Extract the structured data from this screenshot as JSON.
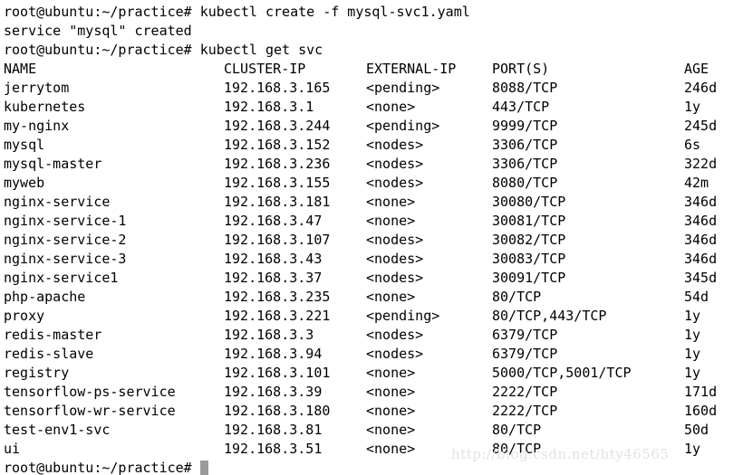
{
  "terminal": {
    "background_color": "#ffffff",
    "text_color": "#000000",
    "cursor_color": "#9a9a9a",
    "prompt": "root@ubuntu:~/practice#",
    "lines": {
      "command_1": "root@ubuntu:~/practice# kubectl create -f mysql-svc1.yaml",
      "output_1": "service \"mysql\" created",
      "command_2": "root@ubuntu:~/practice# kubectl get svc",
      "final_prompt": "root@ubuntu:~/practice#"
    }
  },
  "table": {
    "headers": {
      "name": "NAME",
      "cluster_ip": "CLUSTER-IP",
      "external_ip": "EXTERNAL-IP",
      "ports": "PORT(S)",
      "age": "AGE"
    },
    "rows": [
      {
        "name": "jerrytom",
        "cluster_ip": "192.168.3.165",
        "external_ip": "<pending>",
        "ports": "8088/TCP",
        "age": "246d"
      },
      {
        "name": "kubernetes",
        "cluster_ip": "192.168.3.1",
        "external_ip": "<none>",
        "ports": "443/TCP",
        "age": "1y"
      },
      {
        "name": "my-nginx",
        "cluster_ip": "192.168.3.244",
        "external_ip": "<pending>",
        "ports": "9999/TCP",
        "age": "245d"
      },
      {
        "name": "mysql",
        "cluster_ip": "192.168.3.152",
        "external_ip": "<nodes>",
        "ports": "3306/TCP",
        "age": "6s"
      },
      {
        "name": "mysql-master",
        "cluster_ip": "192.168.3.236",
        "external_ip": "<nodes>",
        "ports": "3306/TCP",
        "age": "322d"
      },
      {
        "name": "myweb",
        "cluster_ip": "192.168.3.155",
        "external_ip": "<nodes>",
        "ports": "8080/TCP",
        "age": "42m"
      },
      {
        "name": "nginx-service",
        "cluster_ip": "192.168.3.181",
        "external_ip": "<none>",
        "ports": "30080/TCP",
        "age": "346d"
      },
      {
        "name": "nginx-service-1",
        "cluster_ip": "192.168.3.47",
        "external_ip": "<none>",
        "ports": "30081/TCP",
        "age": "346d"
      },
      {
        "name": "nginx-service-2",
        "cluster_ip": "192.168.3.107",
        "external_ip": "<nodes>",
        "ports": "30082/TCP",
        "age": "346d"
      },
      {
        "name": "nginx-service-3",
        "cluster_ip": "192.168.3.43",
        "external_ip": "<nodes>",
        "ports": "30083/TCP",
        "age": "346d"
      },
      {
        "name": "nginx-service1",
        "cluster_ip": "192.168.3.37",
        "external_ip": "<nodes>",
        "ports": "30091/TCP",
        "age": "345d"
      },
      {
        "name": "php-apache",
        "cluster_ip": "192.168.3.235",
        "external_ip": "<none>",
        "ports": "80/TCP",
        "age": "54d"
      },
      {
        "name": "proxy",
        "cluster_ip": "192.168.3.221",
        "external_ip": "<pending>",
        "ports": "80/TCP,443/TCP",
        "age": "1y"
      },
      {
        "name": "redis-master",
        "cluster_ip": "192.168.3.3",
        "external_ip": "<nodes>",
        "ports": "6379/TCP",
        "age": "1y"
      },
      {
        "name": "redis-slave",
        "cluster_ip": "192.168.3.94",
        "external_ip": "<nodes>",
        "ports": "6379/TCP",
        "age": "1y"
      },
      {
        "name": "registry",
        "cluster_ip": "192.168.3.101",
        "external_ip": "<none>",
        "ports": "5000/TCP,5001/TCP",
        "age": "1y"
      },
      {
        "name": "tensorflow-ps-service",
        "cluster_ip": "192.168.3.39",
        "external_ip": "<none>",
        "ports": "2222/TCP",
        "age": "171d"
      },
      {
        "name": "tensorflow-wr-service",
        "cluster_ip": "192.168.3.180",
        "external_ip": "<none>",
        "ports": "2222/TCP",
        "age": "160d"
      },
      {
        "name": "test-env1-svc",
        "cluster_ip": "192.168.3.81",
        "external_ip": "<none>",
        "ports": "80/TCP",
        "age": "50d"
      },
      {
        "name": "ui",
        "cluster_ip": "192.168.3.51",
        "external_ip": "<none>",
        "ports": "80/TCP",
        "age": "1y"
      }
    ]
  },
  "watermark": {
    "text": "http://blog.csdn.net/hty46565"
  }
}
